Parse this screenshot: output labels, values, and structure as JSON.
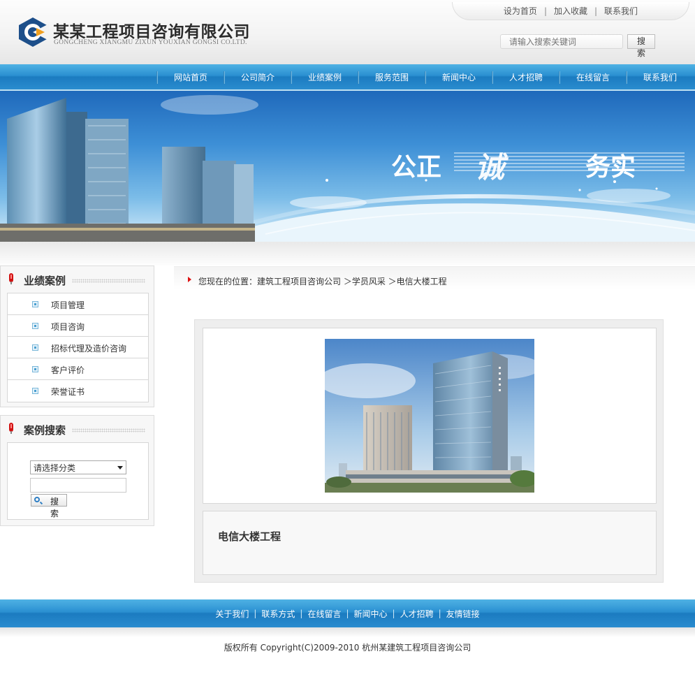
{
  "header": {
    "company_name": "某某工程项目咨询有限公司",
    "company_name_en": "GONGCHENG XIANGMU ZIXUN YOUXIAN GONGSI CO.LTD.",
    "top_links": [
      "设为首页",
      "加入收藏",
      "联系我们"
    ],
    "search_placeholder": "请输入搜索关键词",
    "search_button": "搜 索"
  },
  "nav": {
    "items": [
      "网站首页",
      "公司简介",
      "业绩案例",
      "服务范围",
      "新闻中心",
      "人才招聘",
      "在线留言",
      "联系我们"
    ]
  },
  "banner": {
    "slogan_1": "公正",
    "slogan_2": "诚",
    "slogan_3": "务实"
  },
  "sidebar": {
    "cases_title": "业绩案例",
    "cases": [
      "项目管理",
      "项目咨询",
      "招标代理及造价咨询",
      "客户评价",
      "荣誉证书"
    ],
    "search_title": "案例搜索",
    "category_select": "请选择分类",
    "search_button": "搜 索"
  },
  "breadcrumb": {
    "text": "您现在的位置：建筑工程项目咨询公司 ＞学员风采 ＞电信大楼工程"
  },
  "article": {
    "title": "电信大楼工程"
  },
  "footer": {
    "links": [
      "关于我们",
      "联系方式",
      "在线留言",
      "新闻中心",
      "人才招聘",
      "友情链接"
    ],
    "copyright": "版权所有  Copyright(C)2009-2010 杭州某建筑工程项目咨询公司"
  },
  "colors": {
    "nav_blue": "#2a8fd1",
    "logo_blue": "#1d4f8a",
    "logo_orange": "#f0a020",
    "accent_red": "#d11111"
  }
}
